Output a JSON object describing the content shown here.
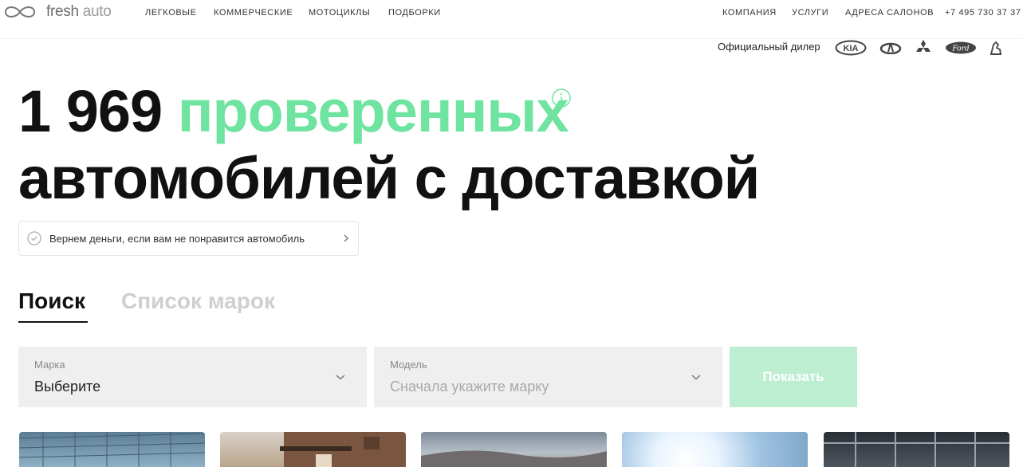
{
  "header": {
    "logo_text_1": "fresh",
    "logo_text_2": "auto",
    "nav_left": [
      "ЛЕГКОВЫЕ",
      "КОММЕРЧЕСКИЕ",
      "МОТОЦИКЛЫ",
      "ПОДБОРКИ"
    ],
    "nav_right": [
      "КОМПАНИЯ",
      "УСЛУГИ",
      "АДРЕСА САЛОНОВ",
      "+7 495 730 37 37"
    ]
  },
  "dealer": {
    "label": "Официальный дилер",
    "brands": [
      "kia-logo",
      "infiniti-logo",
      "mitsubishi-logo",
      "ford-logo",
      "gaz-logo"
    ]
  },
  "hero": {
    "count": "1 969",
    "highlight": "проверенных",
    "line2": "автомобилей с доставкой",
    "guarantee": "Вернем деньги, если вам не понравится автомобиль"
  },
  "tabs": {
    "search": "Поиск",
    "brands": "Список марок"
  },
  "form": {
    "brand_label": "Марка",
    "brand_value": "Выберите",
    "model_label": "Модель",
    "model_value": "Сначала укажите марку",
    "submit": "Показать"
  },
  "colors": {
    "accent_green": "#6fe3a0",
    "button_green": "#bdeed2",
    "field_bg": "#efefef"
  }
}
